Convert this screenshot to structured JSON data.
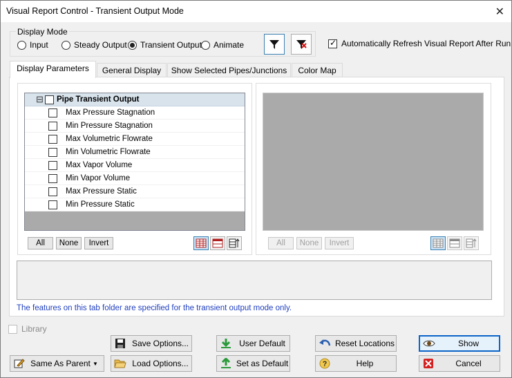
{
  "window": {
    "title": "Visual Report Control - Transient Output Mode",
    "close_icon": "close-icon"
  },
  "display_mode": {
    "label": "Display Mode",
    "options": [
      {
        "label": "Input",
        "selected": false
      },
      {
        "label": "Steady Output",
        "selected": false
      },
      {
        "label": "Transient Output",
        "selected": true
      },
      {
        "label": "Animate",
        "selected": false
      }
    ]
  },
  "auto_refresh": {
    "label": "Automatically Refresh Visual Report After Run",
    "checked": true
  },
  "tabs": [
    {
      "label": "Display Parameters",
      "active": true
    },
    {
      "label": "General Display",
      "active": false
    },
    {
      "label": "Show Selected Pipes/Junctions",
      "active": false
    },
    {
      "label": "Color Map",
      "active": false
    }
  ],
  "tree": {
    "header": "Pipe Transient Output",
    "collapse_glyph": "⊟",
    "items": [
      {
        "label": "Max Pressure Stagnation",
        "checked": false
      },
      {
        "label": "Min Pressure Stagnation",
        "checked": false
      },
      {
        "label": "Max Volumetric Flowrate",
        "checked": false
      },
      {
        "label": "Min Volumetric Flowrate",
        "checked": false
      },
      {
        "label": "Max Vapor Volume",
        "checked": false
      },
      {
        "label": "Min Vapor Volume",
        "checked": false
      },
      {
        "label": "Max Pressure Static",
        "checked": false
      },
      {
        "label": "Min Pressure Static",
        "checked": false
      }
    ]
  },
  "selection_buttons": {
    "all": "All",
    "none": "None",
    "invert": "Invert"
  },
  "note": "The features on this tab folder are specified for the transient output mode only.",
  "library": {
    "label": "Library"
  },
  "buttons": {
    "same_as_parent": "Same As Parent",
    "save_options": "Save Options...",
    "load_options": "Load Options...",
    "user_default": "User Default",
    "set_as_default": "Set as Default",
    "reset_locations": "Reset Locations",
    "help": "Help",
    "show": "Show",
    "cancel": "Cancel"
  }
}
